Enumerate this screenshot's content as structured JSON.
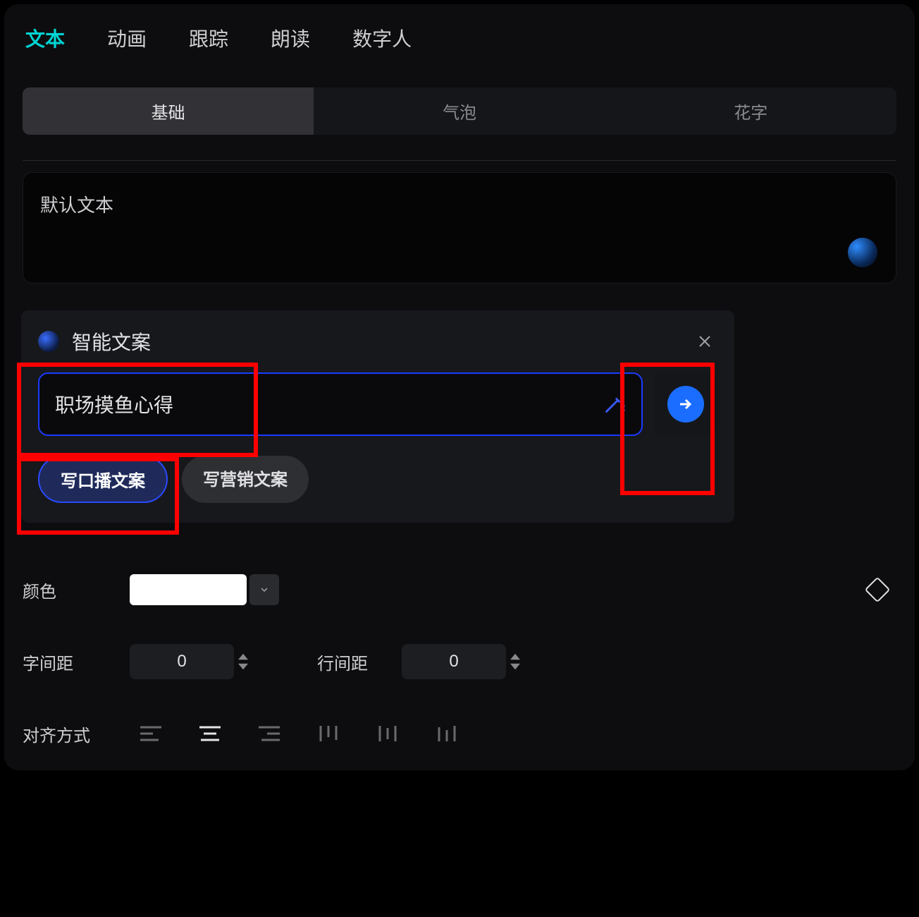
{
  "top_tabs": [
    "文本",
    "动画",
    "跟踪",
    "朗读",
    "数字人"
  ],
  "top_active_index": 0,
  "sub_tabs": [
    "基础",
    "气泡",
    "花字"
  ],
  "sub_active_index": 0,
  "text_box": {
    "value": "默认文本"
  },
  "smart": {
    "title": "智能文案",
    "input_value": "职场摸鱼心得",
    "chip_broadcast": "写口播文案",
    "chip_marketing": "写营销文案",
    "chip_active_index": 0
  },
  "controls": {
    "color_label": "颜色",
    "color_value": "#ffffff",
    "letter_spacing_label": "字间距",
    "letter_spacing_value": "0",
    "line_spacing_label": "行间距",
    "line_spacing_value": "0",
    "align_label": "对齐方式"
  }
}
